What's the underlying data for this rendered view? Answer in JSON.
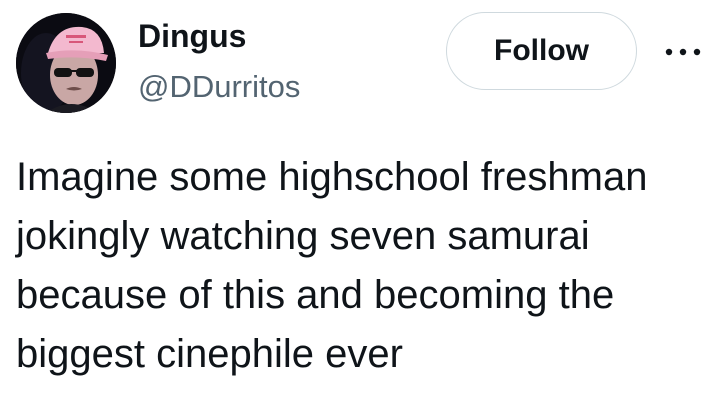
{
  "author": {
    "display_name": "Dingus",
    "handle": "@DDurritos",
    "avatar_icon": "profile-photo-pink-cap-sunglasses"
  },
  "actions": {
    "follow_label": "Follow",
    "more_icon": "more-horizontal-icon"
  },
  "tweet": {
    "lines": [
      "Imagine some highschool freshman",
      "jokingly watching seven samurai",
      "because of this and becoming the",
      "biggest cinephile ever"
    ]
  },
  "colors": {
    "text_primary": "#0f1419",
    "text_secondary": "#536471",
    "button_border": "#cfd9de",
    "avatar_cap": "#f3b9cf"
  }
}
